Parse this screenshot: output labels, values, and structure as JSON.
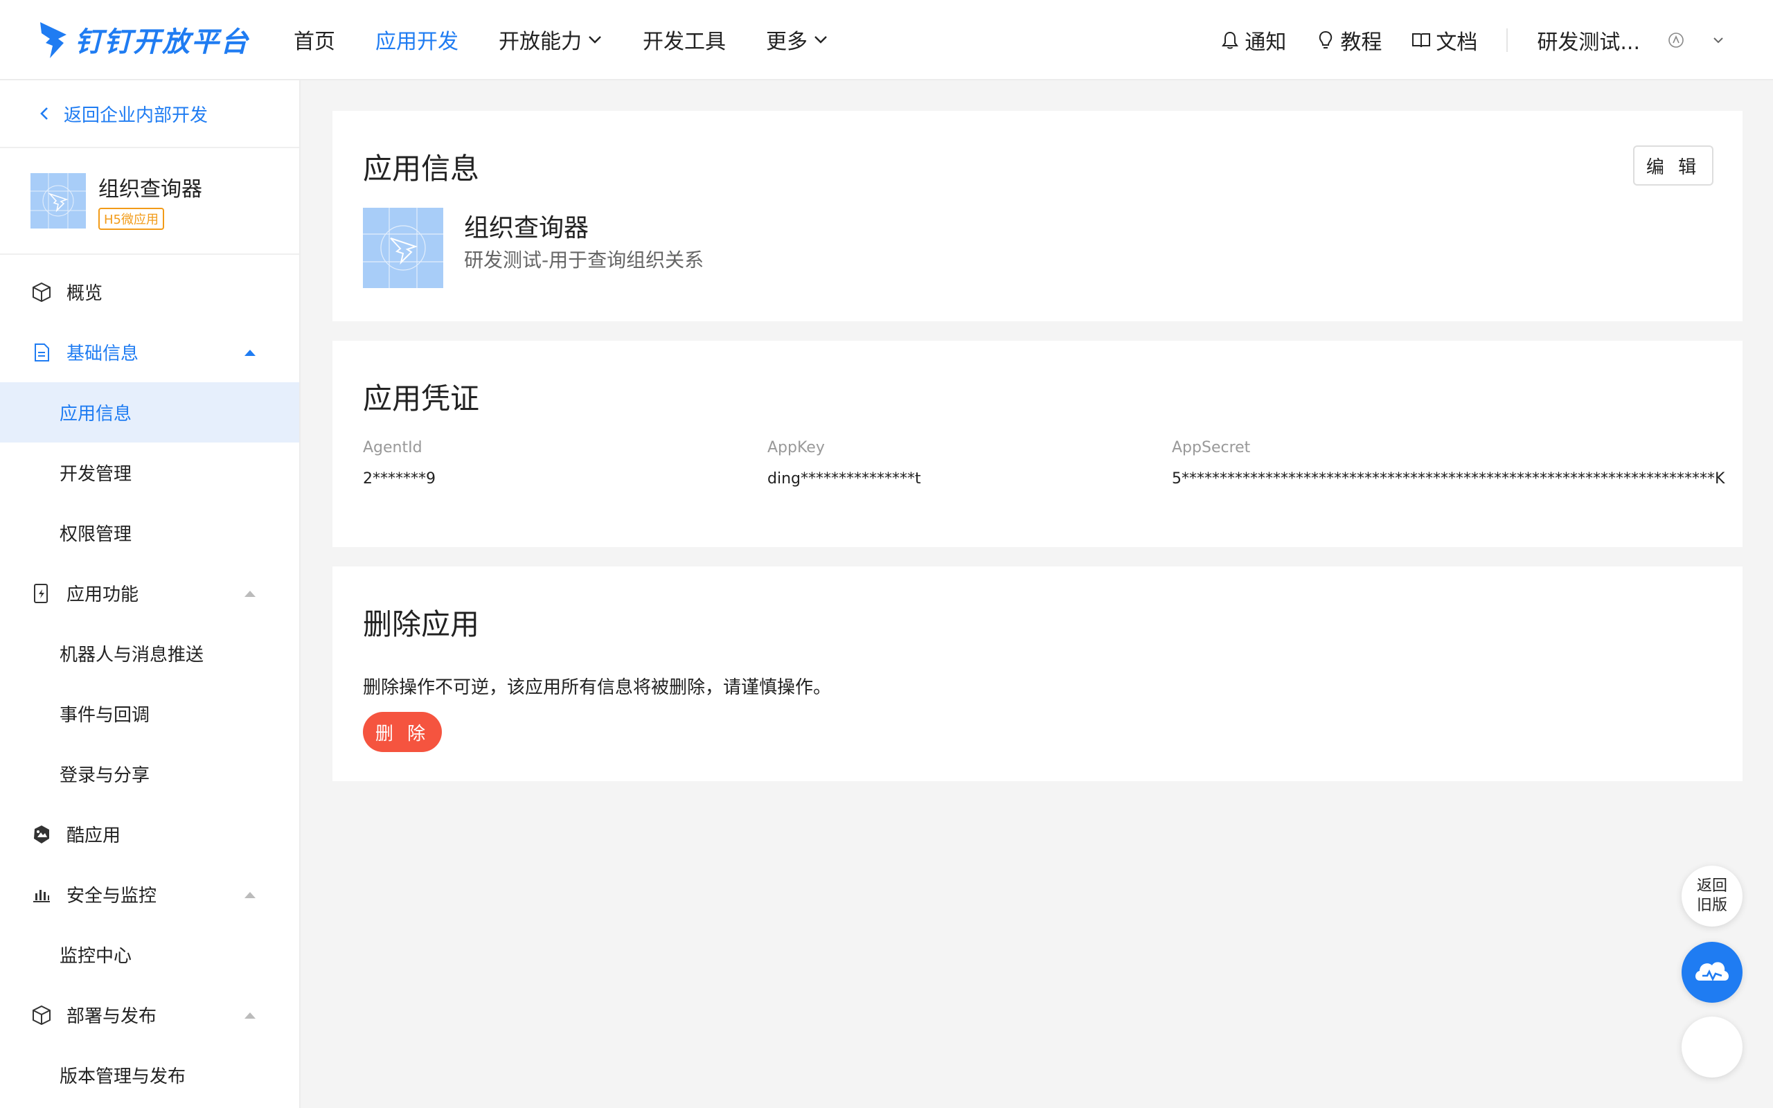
{
  "brand": {
    "name": "钉钉开放平台",
    "color": "#1f7cf2"
  },
  "nav": {
    "items": [
      {
        "label": "首页"
      },
      {
        "label": "应用开发"
      },
      {
        "label": "开放能力"
      },
      {
        "label": "开发工具"
      },
      {
        "label": "更多"
      }
    ],
    "active": "应用开发",
    "notify": "通知",
    "tutorial": "教程",
    "docs": "文档",
    "user": "研发测试..."
  },
  "sidebar": {
    "back": "返回企业内部开发",
    "app_name": "组织查询器",
    "app_badge": "H5微应用",
    "overview": "概览",
    "basic_info": "基础信息",
    "basic_sub": [
      "应用信息",
      "开发管理",
      "权限管理"
    ],
    "app_features": "应用功能",
    "features_sub": [
      "机器人与消息推送",
      "事件与回调",
      "登录与分享"
    ],
    "cool_app": "酷应用",
    "security": "安全与监控",
    "security_sub": [
      "监控中心"
    ],
    "deploy": "部署与发布",
    "deploy_sub": [
      "版本管理与发布"
    ],
    "selected": "应用信息"
  },
  "app_info": {
    "title": "应用信息",
    "edit": "编 辑",
    "name": "组织查询器",
    "desc": "研发测试-用于查询组织关系"
  },
  "credentials": {
    "title": "应用凭证",
    "agent_label": "AgentId",
    "agent_value": "2*******9",
    "key_label": "AppKey",
    "key_value": "ding***************t",
    "secret_label": "AppSecret",
    "secret_value": "5**********************************************************************K"
  },
  "delete": {
    "title": "删除应用",
    "text": "删除操作不可逆，该应用所有信息将被删除，请谨慎操作。",
    "button": "删 除",
    "button_color": "#f5543f"
  },
  "float": {
    "old_version": "返回旧版"
  },
  "icons": [
    "dingtalk-logo-icon",
    "chevron-down-icon",
    "bell-icon",
    "bulb-icon",
    "book-icon",
    "avatar-icon",
    "chevron-left-icon",
    "cube-icon",
    "document-icon",
    "caret-up-icon",
    "phone-bolt-icon",
    "cool-app-icon",
    "bar-chart-icon",
    "assistant-icon"
  ]
}
